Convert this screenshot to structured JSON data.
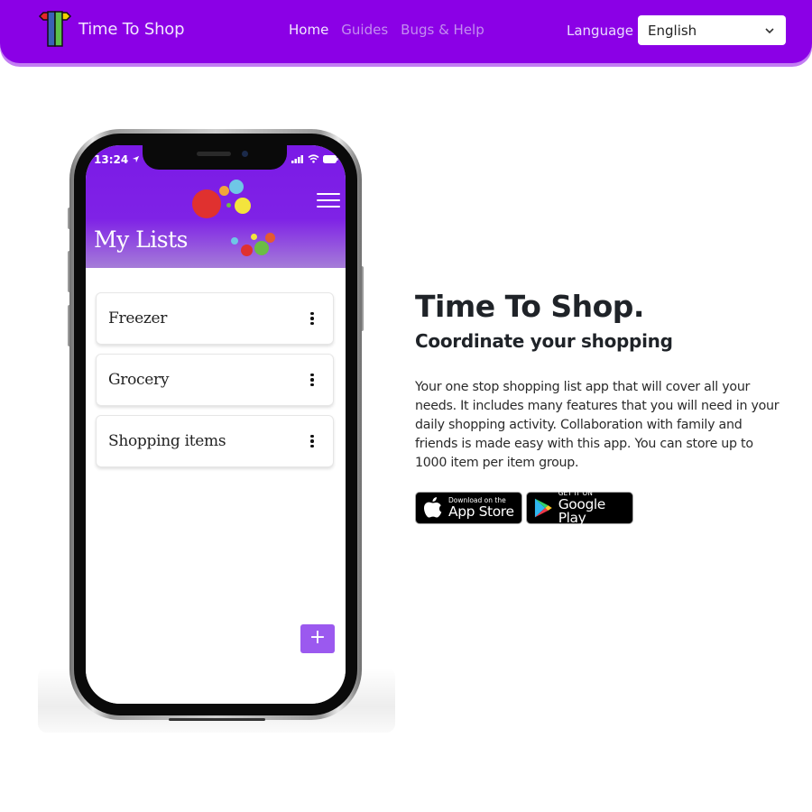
{
  "header": {
    "brand_name": "Time To Shop",
    "nav": [
      {
        "label": "Home",
        "active": true
      },
      {
        "label": "Guides",
        "active": false
      },
      {
        "label": "Bugs & Help",
        "active": false
      }
    ],
    "language_label": "Language",
    "language_selected": "English"
  },
  "phone": {
    "status_time": "13:24",
    "screen_title": "My Lists",
    "lists": [
      {
        "label": "Freezer"
      },
      {
        "label": "Grocery"
      },
      {
        "label": "Shopping items"
      }
    ],
    "fab_label": "+"
  },
  "hero": {
    "title": "Time To Shop.",
    "subtitle": "Coordinate your shopping",
    "description": "Your one stop shopping list app that will cover all your needs. It includes many features that you will need in your daily shopping activity. Collaboration with family and friends is made easy with this app. You can store up to 1000 item per item group.",
    "app_store": {
      "small": "Download on the",
      "big": "App Store"
    },
    "google_play": {
      "small": "GET IT ON",
      "big": "Google Play"
    }
  },
  "colors": {
    "brand_purple": "#8b00e6",
    "fab_purple": "#9b59ef"
  }
}
